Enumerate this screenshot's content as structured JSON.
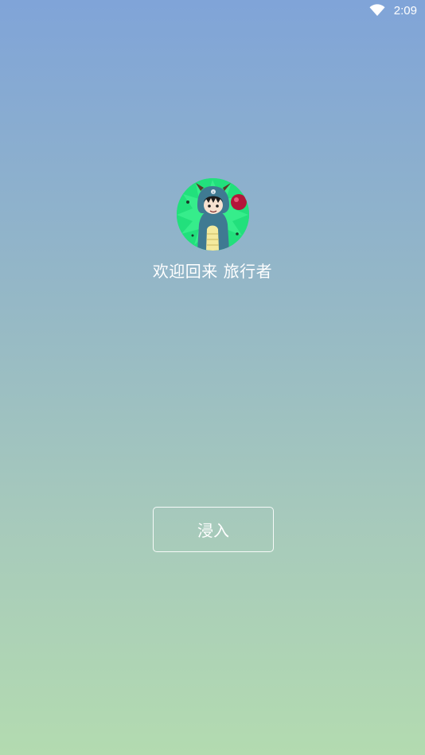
{
  "status_bar": {
    "time": "2:09",
    "icons": [
      "wifi-icon"
    ]
  },
  "profile": {
    "welcome_text": "欢迎回来 旅行者",
    "avatar_icon": "cartoon-dragon-costume-avatar"
  },
  "actions": {
    "enter_label": "浸入"
  },
  "colors": {
    "gradient_top": "#80a4d8",
    "gradient_bottom": "#b3dbb0",
    "text": "#ffffff",
    "avatar_background": "#1ee07a"
  }
}
